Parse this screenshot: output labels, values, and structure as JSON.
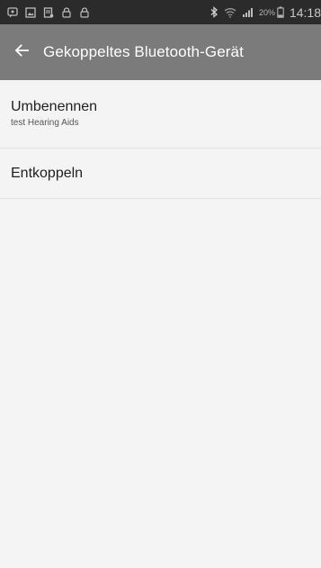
{
  "status_bar": {
    "left_icons": [
      "message-icon",
      "image-icon",
      "note-icon",
      "lock-icon",
      "lock-icon"
    ],
    "right_icons": [
      "bluetooth-icon",
      "wifi-icon",
      "signal-icon"
    ],
    "battery_percent": "20%",
    "time": "14:18"
  },
  "app_bar": {
    "back_icon": "arrow-left-icon",
    "title": "Gekoppeltes Bluetooth-Gerät"
  },
  "list": {
    "rename": {
      "title": "Umbenennen",
      "subtitle": "test Hearing Aids"
    },
    "unpair": {
      "title": "Entkoppeln"
    }
  },
  "colors": {
    "status_bar": "#2b2b2b",
    "app_bar": "#7b7b7b",
    "background": "#f4f4f4",
    "divider": "#e2e2e2"
  }
}
